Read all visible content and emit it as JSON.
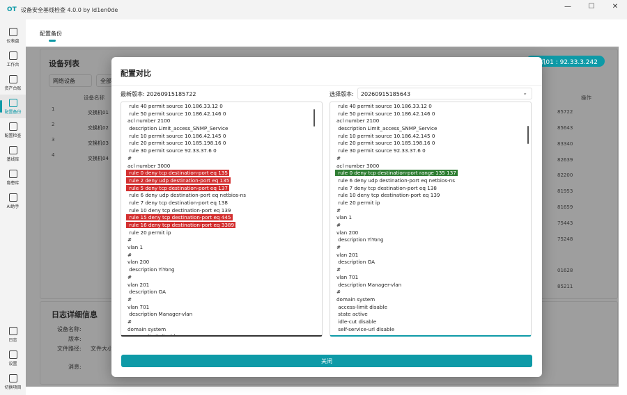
{
  "app": {
    "logo": "OT",
    "title": "设备安全基线检查 4.0.0 by ld1en0de"
  },
  "window_controls": [
    "—",
    "☐",
    "✕"
  ],
  "sidebar": {
    "top_items": [
      {
        "label": "仪表盘",
        "icon": "dashboard-icon",
        "active": false
      },
      {
        "label": "工作台",
        "icon": "workbench-icon",
        "active": false
      },
      {
        "label": "资产台账",
        "icon": "assets-icon",
        "active": false
      },
      {
        "label": "配置备份",
        "icon": "download-icon",
        "active": true
      },
      {
        "label": "配置检查",
        "icon": "shield-icon",
        "active": false
      },
      {
        "label": "基线库",
        "icon": "save-icon",
        "active": false
      },
      {
        "label": "隐患库",
        "icon": "warning-icon",
        "active": false
      },
      {
        "label": "AI助手",
        "icon": "ai-icon",
        "active": false
      }
    ],
    "bottom_items": [
      {
        "label": "日志",
        "icon": "menu-icon"
      },
      {
        "label": "设置",
        "icon": "gear-icon"
      },
      {
        "label": "切换项目",
        "icon": "back-icon"
      }
    ]
  },
  "main": {
    "tab": "配置备份",
    "device_list_title": "设备列表",
    "filter_1": "网络设备",
    "filter_2": "全部",
    "col_name": "设备名称",
    "col_actions": "操作",
    "badge": "换机01 : 92.33.3.242",
    "rows": [
      {
        "num": "1",
        "name": "交换机01"
      },
      {
        "num": "2",
        "name": "交换机02"
      },
      {
        "num": "3",
        "name": "交换机03"
      },
      {
        "num": "4",
        "name": "交换机04"
      }
    ],
    "files": [
      "85722",
      "85643",
      "83340",
      "82639",
      "82200",
      "81953",
      "81659",
      "75443",
      "75248",
      "",
      "01628",
      "85211"
    ],
    "log_title": "日志详细信息",
    "log_device": "设备名称:",
    "log_version": "版本:",
    "log_path": "文件路径:",
    "log_size": "文件大小",
    "log_message": "消息:"
  },
  "dialog": {
    "title": "配置对比",
    "left_label": "最新版本:",
    "left_version": "20260915185722",
    "right_label": "选择版本:",
    "right_version": "20260915185643",
    "close_label": "关闭",
    "left_lines": [
      {
        "t": " rule 40 permit source 10.186.33.12 0",
        "h": ""
      },
      {
        "t": " rule 50 permit source 10.186.42.146 0",
        "h": ""
      },
      {
        "t": "acl number 2100",
        "h": ""
      },
      {
        "t": " description Limit_access_SNMP_Service",
        "h": ""
      },
      {
        "t": " rule 10 permit source 10.186.42.145 0",
        "h": ""
      },
      {
        "t": " rule 20 permit source 10.185.198.16 0",
        "h": ""
      },
      {
        "t": " rule 30 permit source 92.33.37.6 0",
        "h": ""
      },
      {
        "t": "#",
        "h": ""
      },
      {
        "t": "acl number 3000",
        "h": ""
      },
      {
        "t": " rule 0 deny tcp destination-port eq 135",
        "h": "red"
      },
      {
        "t": " rule 2 deny udp destination-port eq 135",
        "h": "red"
      },
      {
        "t": " rule 5 deny tcp destination-port eq 137",
        "h": "red"
      },
      {
        "t": " rule 6 deny udp destination-port eq netbios-ns",
        "h": ""
      },
      {
        "t": " rule 7 deny tcp destination-port eq 138",
        "h": ""
      },
      {
        "t": " rule 10 deny tcp destination-port eq 139",
        "h": ""
      },
      {
        "t": " rule 15 deny tcp destination-port eq 445",
        "h": "red"
      },
      {
        "t": " rule 16 deny tcp destination-port eq 3389",
        "h": "red"
      },
      {
        "t": " rule 20 permit ip",
        "h": ""
      },
      {
        "t": "#",
        "h": ""
      },
      {
        "t": "vlan 1",
        "h": ""
      },
      {
        "t": "#",
        "h": ""
      },
      {
        "t": "vlan 200",
        "h": ""
      },
      {
        "t": " description YiYong",
        "h": ""
      },
      {
        "t": "#",
        "h": ""
      },
      {
        "t": "vlan 201",
        "h": ""
      },
      {
        "t": " description OA",
        "h": ""
      },
      {
        "t": "#",
        "h": ""
      },
      {
        "t": "vlan 701",
        "h": ""
      },
      {
        "t": " description Manager-vlan",
        "h": ""
      },
      {
        "t": "#",
        "h": ""
      },
      {
        "t": "domain system",
        "h": ""
      },
      {
        "t": " access-limit disable",
        "h": ""
      }
    ],
    "right_lines": [
      {
        "t": " rule 40 permit source 10.186.33.12 0",
        "h": ""
      },
      {
        "t": " rule 50 permit source 10.186.42.146 0",
        "h": ""
      },
      {
        "t": "acl number 2100",
        "h": ""
      },
      {
        "t": " description Limit_access_SNMP_Service",
        "h": ""
      },
      {
        "t": " rule 10 permit source 10.186.42.145 0",
        "h": ""
      },
      {
        "t": " rule 20 permit source 10.185.198.16 0",
        "h": ""
      },
      {
        "t": " rule 30 permit source 92.33.37.6 0",
        "h": ""
      },
      {
        "t": "#",
        "h": ""
      },
      {
        "t": "acl number 3000",
        "h": ""
      },
      {
        "t": " rule 0 deny tcp destination-port range 135 137",
        "h": "green"
      },
      {
        "t": " rule 6 deny udp destination-port eq netbios-ns",
        "h": ""
      },
      {
        "t": " rule 7 deny tcp destination-port eq 138",
        "h": ""
      },
      {
        "t": " rule 10 deny tcp destination-port eq 139",
        "h": ""
      },
      {
        "t": " rule 20 permit ip",
        "h": ""
      },
      {
        "t": "#",
        "h": ""
      },
      {
        "t": "vlan 1",
        "h": ""
      },
      {
        "t": "#",
        "h": ""
      },
      {
        "t": "vlan 200",
        "h": ""
      },
      {
        "t": " description YiYong",
        "h": ""
      },
      {
        "t": "#",
        "h": ""
      },
      {
        "t": "vlan 201",
        "h": ""
      },
      {
        "t": " description OA",
        "h": ""
      },
      {
        "t": "#",
        "h": ""
      },
      {
        "t": "vlan 701",
        "h": ""
      },
      {
        "t": " description Manager-vlan",
        "h": ""
      },
      {
        "t": "#",
        "h": ""
      },
      {
        "t": "domain system",
        "h": ""
      },
      {
        "t": " access-limit disable",
        "h": ""
      },
      {
        "t": " state active",
        "h": ""
      },
      {
        "t": " idle-cut disable",
        "h": ""
      },
      {
        "t": " self-service-url disable",
        "h": ""
      }
    ]
  },
  "colors": {
    "accent": "#0e9aa7",
    "diff_removed": "#d32f2f",
    "diff_added": "#2e7d32"
  }
}
